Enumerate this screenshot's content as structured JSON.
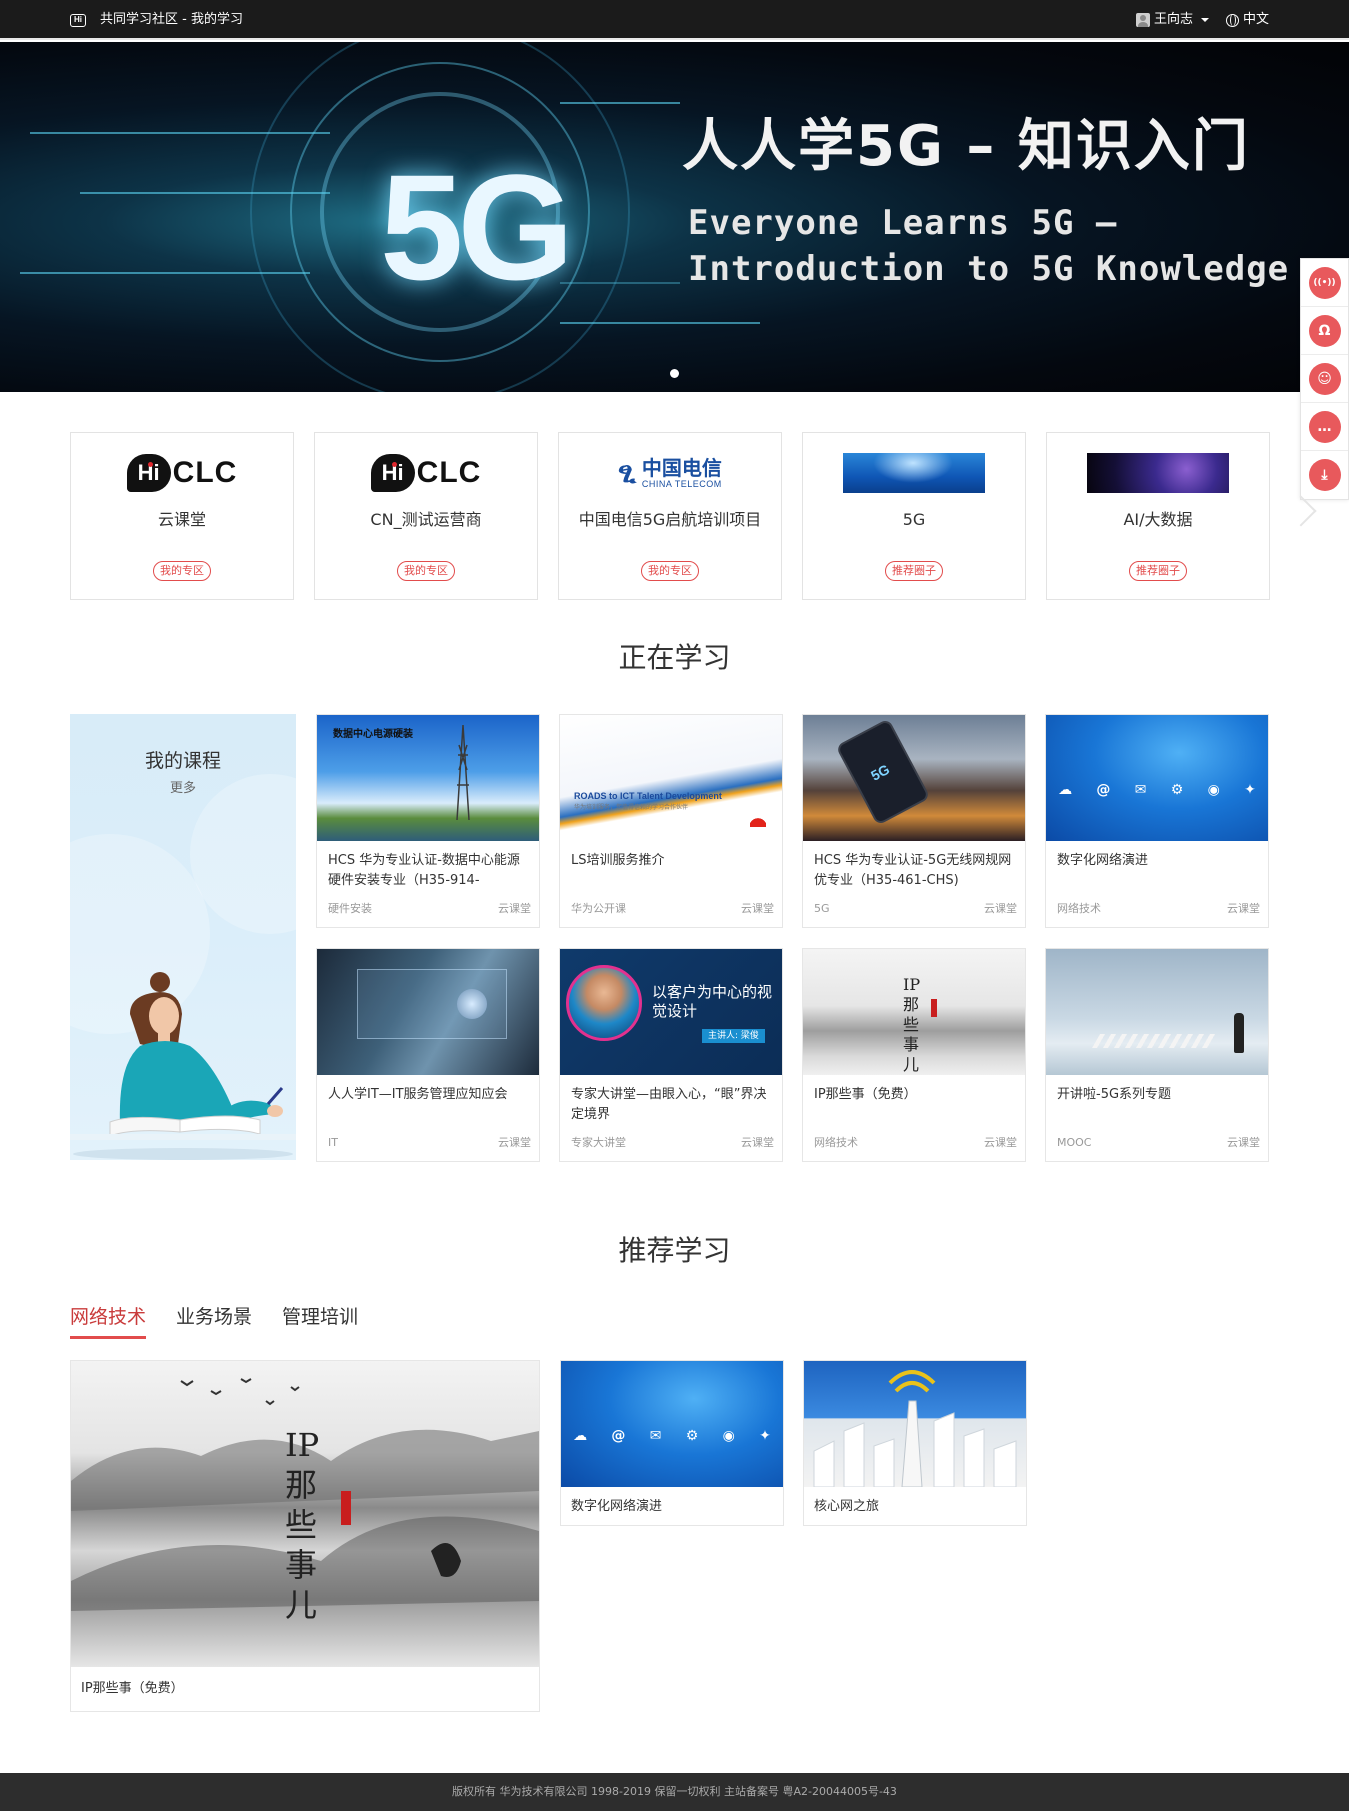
{
  "header": {
    "logo_text": "Hi",
    "title": "共同学习社区 - 我的学习",
    "user_name": "王向志",
    "language": "中文"
  },
  "banner": {
    "big_text": "5G",
    "cn_title": "人人学5G – 知识入门",
    "en_line1": "Everyone Learns 5G –",
    "en_line2": "Introduction to 5G Knowledge"
  },
  "side_tools": [
    {
      "icon": "broadcast-icon",
      "glyph": "((•))"
    },
    {
      "icon": "headset-icon",
      "glyph": "Ω"
    },
    {
      "icon": "support-agent-icon",
      "glyph": "☺"
    },
    {
      "icon": "message-icon",
      "glyph": "…"
    },
    {
      "icon": "download-icon",
      "glyph": "⤓"
    }
  ],
  "zones": [
    {
      "name": "云课堂",
      "tag": "我的专区",
      "logo": "hiclc"
    },
    {
      "name": "CN_测试运营商",
      "tag": "我的专区",
      "logo": "hiclc"
    },
    {
      "name": "中国电信5G启航培训项目",
      "tag": "我的专区",
      "logo": "china-telecom"
    },
    {
      "name": "5G",
      "tag": "推荐圈子",
      "logo": "5g-image"
    },
    {
      "name": "AI/大数据",
      "tag": "推荐圈子",
      "logo": "ai-image"
    }
  ],
  "logos": {
    "hi": "Hi",
    "clc": "CLC",
    "telecom_cn": "中国电信",
    "telecom_en": "CHINA TELECOM"
  },
  "studying": {
    "section_title": "正在学习",
    "my_course_title": "我的课程",
    "my_course_more": "更多",
    "courses": [
      {
        "title": "HCS 华为专业认证-数据中心能源硬件安装专业（H35-914-",
        "category": "硬件安装",
        "source": "云课堂",
        "thumb_text": "数据中心电源硬装"
      },
      {
        "title": "LS培训服务推介",
        "category": "华为公开课",
        "source": "云课堂",
        "thumb_text": "ROADS to ICT Talent Development",
        "thumb_sub": "华为培训服务，您值得信赖的学习合作伙伴"
      },
      {
        "title": "HCS 华为专业认证-5G无线网规网优专业（H35-461-CHS)",
        "category": "5G",
        "source": "云课堂",
        "thumb_text": "5G"
      },
      {
        "title": "数字化网络演进",
        "category": "网络技术",
        "source": "云课堂"
      },
      {
        "title": "人人学IT—IT服务管理应知应会",
        "category": "IT",
        "source": "云课堂"
      },
      {
        "title": "专家大讲堂—由眼入心，“眼”界决定境界",
        "category": "专家大讲堂",
        "source": "云课堂",
        "thumb_text": "以客户为中心的视觉设计",
        "thumb_sub": "主讲人: 梁俊"
      },
      {
        "title": "IP那些事（免费）",
        "category": "网络技术",
        "source": "云课堂",
        "thumb_text": "IP那些事儿"
      },
      {
        "title": "开讲啦-5G系列专题",
        "category": "MOOC",
        "source": "云课堂"
      }
    ]
  },
  "recommended": {
    "section_title": "推荐学习",
    "tabs": [
      "网络技术",
      "业务场景",
      "管理培训"
    ],
    "active_tab": 0,
    "big_card": {
      "title": "IP那些事（免费）",
      "thumb_text": "IP那些事儿"
    },
    "small_cards": [
      {
        "title": "数字化网络演进"
      },
      {
        "title": "核心网之旅"
      }
    ]
  },
  "footer": {
    "text": "版权所有 华为技术有限公司 1998-2019 保留一切权利 主站备案号   粤A2-20044005号-43"
  }
}
